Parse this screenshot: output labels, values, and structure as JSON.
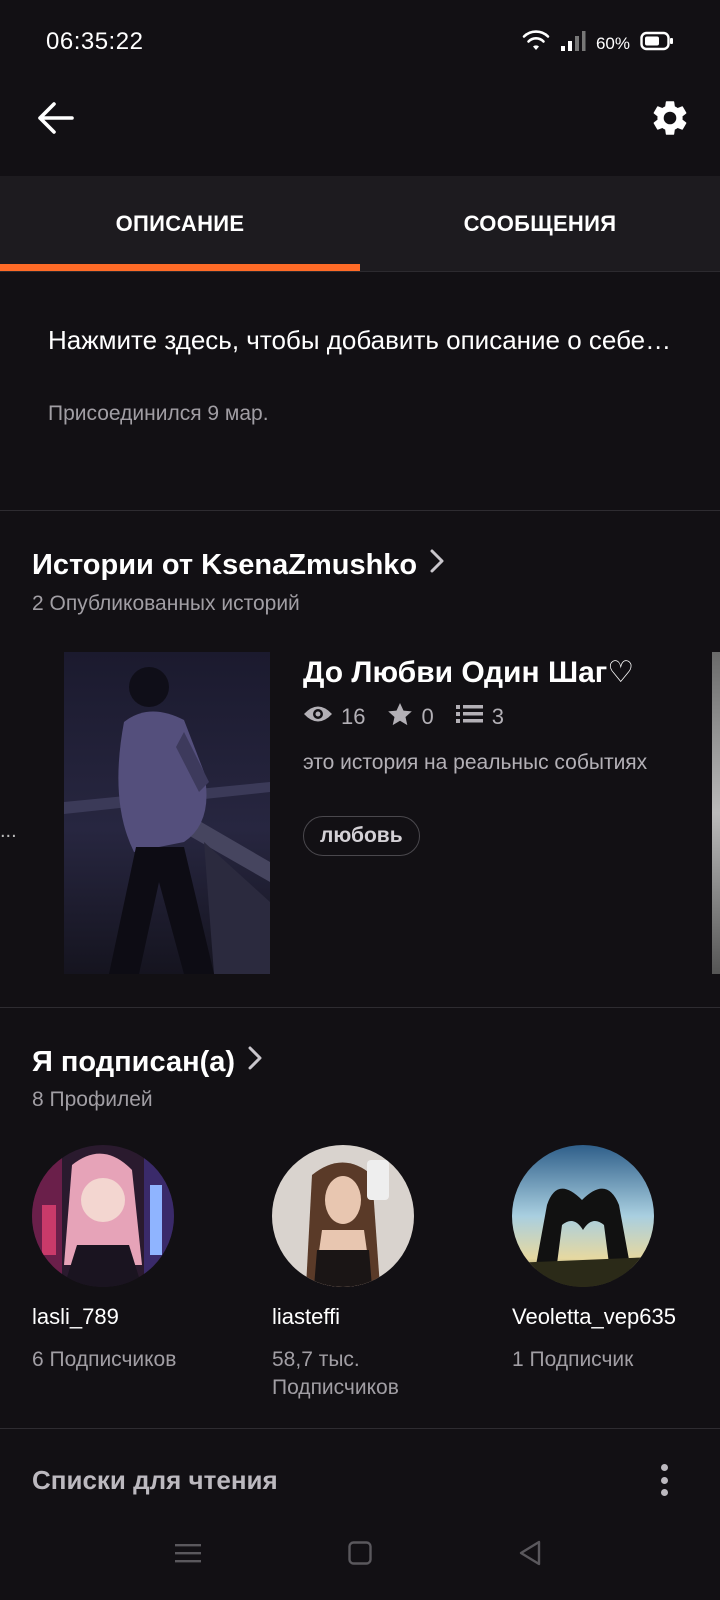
{
  "status_bar": {
    "time": "06:35:22",
    "battery_percent": "60%",
    "icons": [
      "wifi-icon",
      "signal-icon",
      "battery-icon"
    ]
  },
  "app_bar": {
    "back_icon": "arrow-left-icon",
    "settings_icon": "gear-icon"
  },
  "tabs": [
    {
      "label": "ОПИСАНИЕ",
      "active": true
    },
    {
      "label": "СООБЩЕНИЯ",
      "active": false
    }
  ],
  "about": {
    "description": "Нажмите здесь, чтобы добавить описание о себе…",
    "joined": "Присоединился 9 мар."
  },
  "stories_section": {
    "title": "Истории от KsenaZmushko",
    "subtitle": "2 Опубликованных историй",
    "left_ellipsis": "...",
    "story": {
      "title": "До Любви Один Шаг♡",
      "views": "16",
      "votes": "0",
      "parts": "3",
      "description": "это история на реальныс событиях",
      "tag": "любовь"
    }
  },
  "following_section": {
    "title": "Я подписан(а)",
    "subtitle": "8 Профилей",
    "profiles": [
      {
        "name": "lasli_789",
        "followers": "6 Подписчиков"
      },
      {
        "name": "liasteffi",
        "followers": "58,7 тыс. Подписчиков"
      },
      {
        "name": "Veoletta_vep635",
        "followers": "1 Подписчик"
      }
    ]
  },
  "reading_lists": {
    "title": "Списки для чтения"
  },
  "colors": {
    "accent": "#ff6b27",
    "background": "#121014",
    "tab_background": "#1d1b1f"
  }
}
